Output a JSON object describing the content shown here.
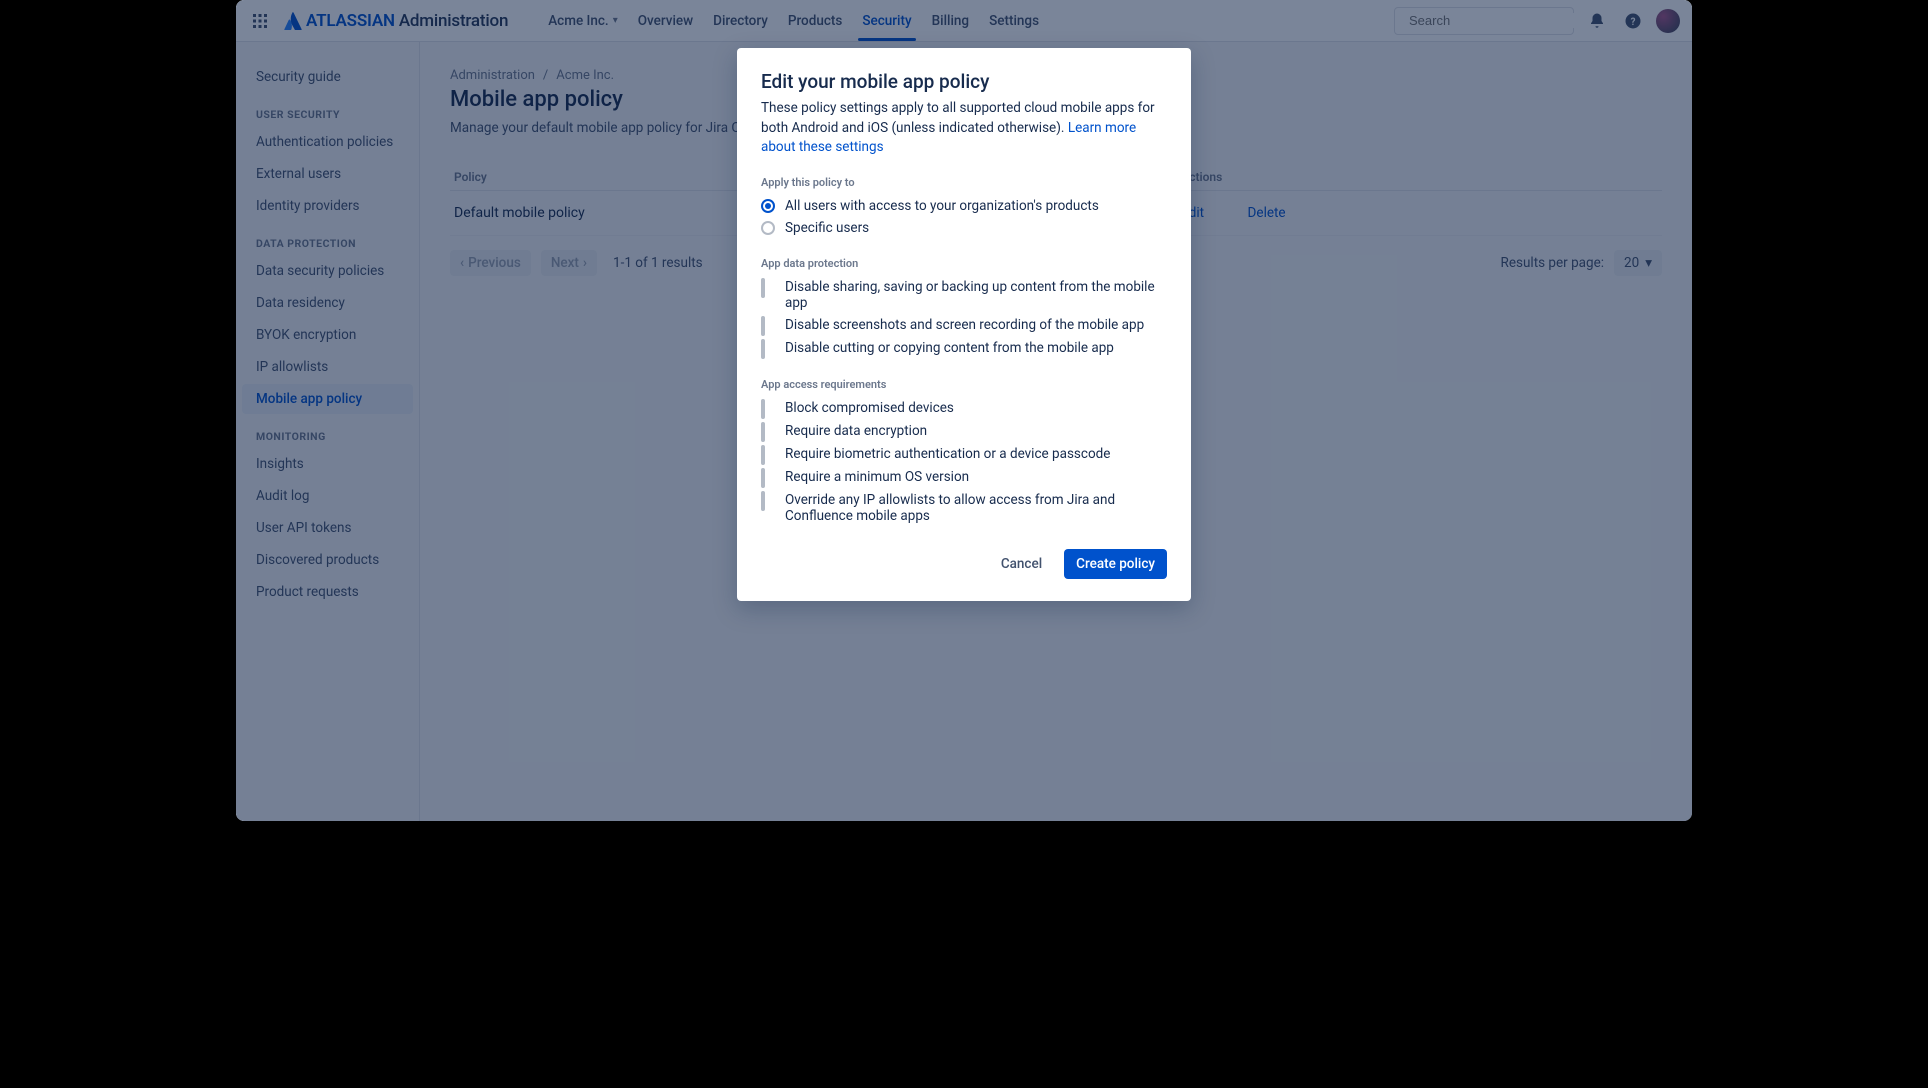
{
  "header": {
    "brand_primary": "ATLASSIAN",
    "brand_secondary": "Administration",
    "org_switcher": "Acme Inc.",
    "nav": [
      "Overview",
      "Directory",
      "Products",
      "Security",
      "Billing",
      "Settings"
    ],
    "nav_active_index": 3,
    "search_placeholder": "Search"
  },
  "sidebar": {
    "top_links": [
      "Security guide"
    ],
    "groups": [
      {
        "heading": "User security",
        "items": [
          "Authentication policies",
          "External users",
          "Identity providers"
        ]
      },
      {
        "heading": "Data protection",
        "items": [
          "Data security policies",
          "Data residency",
          "BYOK encryption",
          "IP allowlists",
          "Mobile app policy"
        ],
        "selected_index": 4
      },
      {
        "heading": "Monitoring",
        "items": [
          "Insights",
          "Audit log",
          "User API tokens",
          "Discovered products",
          "Product requests"
        ]
      }
    ]
  },
  "page": {
    "breadcrumb": [
      "Administration",
      "Acme Inc."
    ],
    "title": "Mobile app policy",
    "description": "Manage your default mobile app policy for Jira Cloud, Con",
    "table": {
      "columns": [
        "Policy",
        "Actions"
      ],
      "rows": [
        {
          "policy": "Default mobile policy",
          "actions": [
            "Edit",
            "Delete"
          ]
        }
      ]
    },
    "pager": {
      "prev": "Previous",
      "next": "Next",
      "status": "1-1 of 1 results",
      "per_page_label": "Results per page:",
      "per_page_value": "20"
    }
  },
  "modal": {
    "title": "Edit your mobile app policy",
    "description": "These policy settings apply to all supported cloud mobile apps for both Android and iOS (unless indicated otherwise). ",
    "learn_more": "Learn more about these settings",
    "apply_heading": "Apply this policy to",
    "apply_options": [
      {
        "label": "All users with access to your organization's products",
        "selected": true
      },
      {
        "label": "Specific users",
        "selected": false
      }
    ],
    "data_protection_heading": "App data protection",
    "data_protection_options": [
      "Disable sharing, saving or backing up content from the mobile app",
      "Disable screenshots and screen recording of the mobile app",
      "Disable cutting or copying content from the mobile app"
    ],
    "access_heading": "App access requirements",
    "access_options": [
      "Block compromised devices",
      "Require data encryption",
      "Require biometric authentication or a device passcode",
      "Require a minimum OS version",
      "Override any IP allowlists to allow access from Jira and Confluence mobile apps"
    ],
    "cancel": "Cancel",
    "submit": "Create policy"
  }
}
